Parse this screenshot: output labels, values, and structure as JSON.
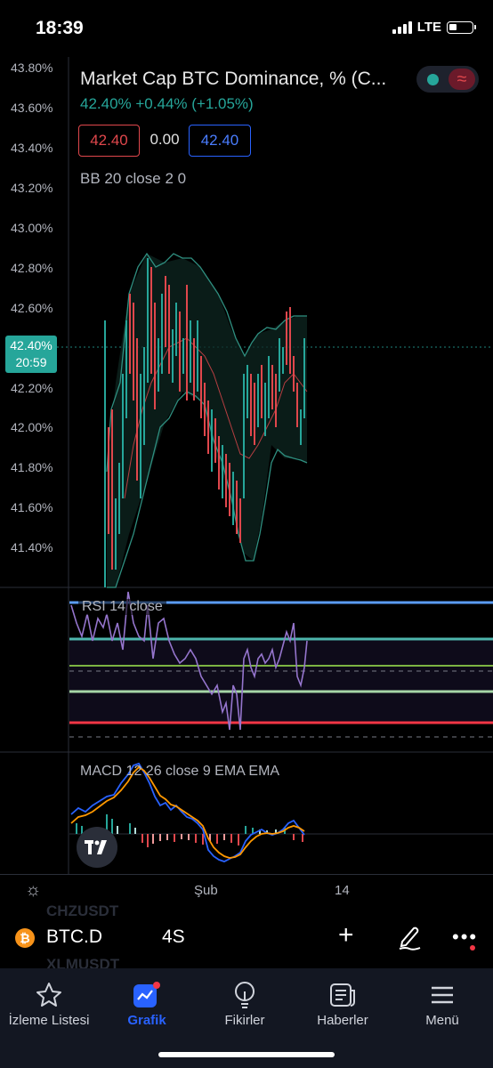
{
  "status": {
    "time": "18:39",
    "network": "LTE"
  },
  "chart": {
    "title": "Market Cap BTC Dominance, % (C...",
    "change": "42.40%  +0.44% (+1.05%)",
    "box_left": "42.40",
    "box_mid": "0.00",
    "box_right": "42.40",
    "bb_label": "BB 20 close 2 0",
    "price_labels": [
      "43.80%",
      "43.60%",
      "43.40%",
      "43.20%",
      "43.00%",
      "42.80%",
      "42.60%",
      "42.20%",
      "42.00%",
      "41.80%",
      "41.60%",
      "41.40%"
    ],
    "current_price": "42.40%",
    "countdown": "20:59",
    "rsi_label": "RSI 14 close",
    "macd_label": "MACD 12 26 close 9 EMA EMA",
    "time_labels": [
      "Şub",
      "14"
    ],
    "colors": {
      "up": "#26a69a",
      "down": "#e0474c",
      "bb": "#2f8f80",
      "rsi": "#7e57c2",
      "macd": "#2962ff",
      "signal": "#ff9800"
    }
  },
  "symbol_bar": {
    "ghost_top": "CHZUSDT",
    "ghost_bottom": "XLMUSDT",
    "symbol": "BTC.D",
    "interval": "4S",
    "icons": [
      "bitcoin-icon",
      "plus-icon",
      "pen-icon",
      "more-icon"
    ]
  },
  "tabs": [
    {
      "label": "İzleme Listesi",
      "icon": "star-icon"
    },
    {
      "label": "Grafik",
      "icon": "chart-icon",
      "active": true
    },
    {
      "label": "Fikirler",
      "icon": "bulb-icon"
    },
    {
      "label": "Haberler",
      "icon": "news-icon"
    },
    {
      "label": "Menü",
      "icon": "menu-icon"
    }
  ]
}
